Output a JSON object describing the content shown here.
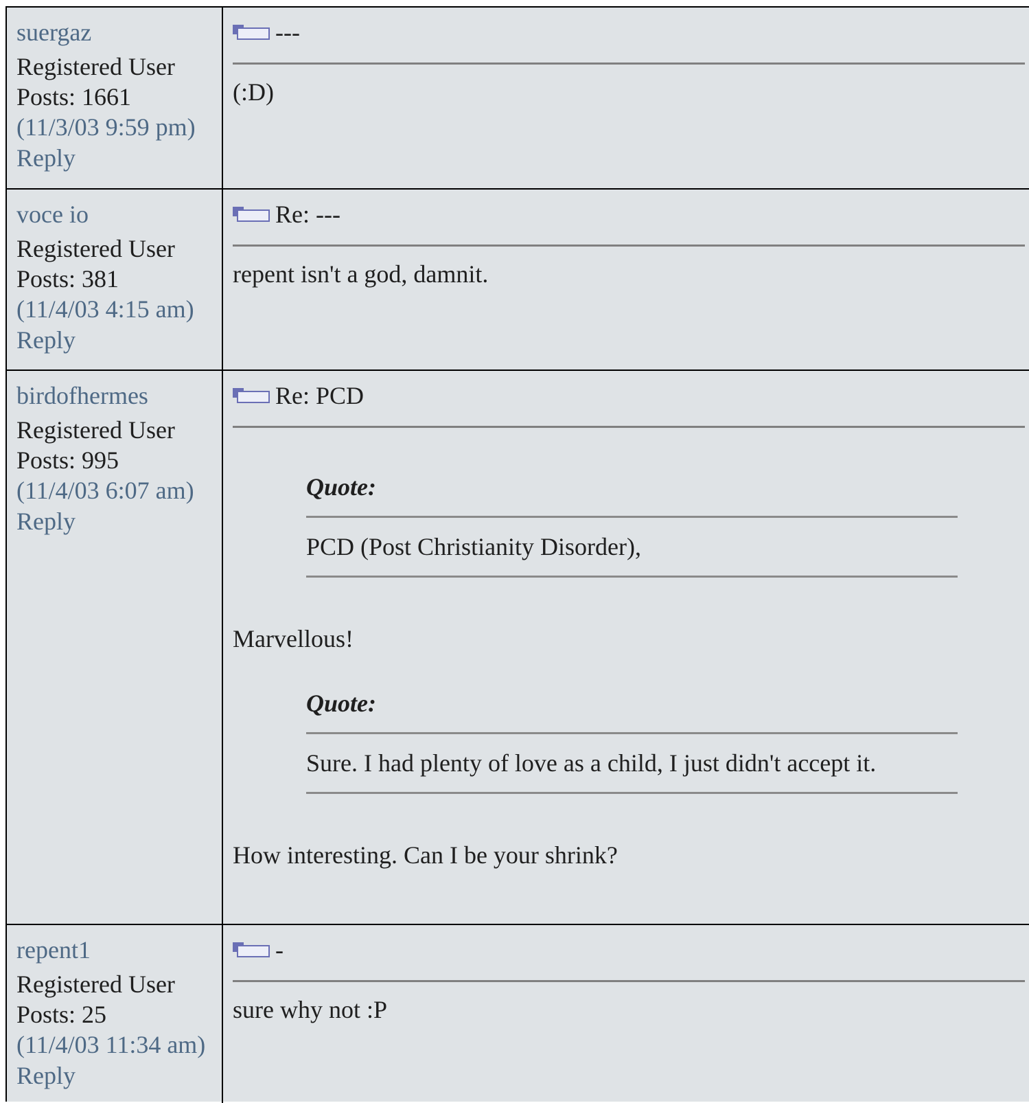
{
  "posts": [
    {
      "author": "suergaz",
      "rank": "Registered User",
      "posts_count": "Posts: 1661",
      "date": "(11/3/03 9:59 pm)",
      "reply": "Reply",
      "subject": "---",
      "body": [
        "(:D)"
      ]
    },
    {
      "author": "voce io",
      "rank": "Registered User",
      "posts_count": "Posts: 381",
      "date": "(11/4/03 4:15 am)",
      "reply": "Reply",
      "subject": "Re: ---",
      "body": [
        "repent isn't a god, damnit."
      ]
    },
    {
      "author": "birdofhermes",
      "rank": "Registered User",
      "posts_count": "Posts: 995",
      "date": "(11/4/03 6:07 am)",
      "reply": "Reply",
      "subject": "Re: PCD",
      "quote_label": "Quote:",
      "quote1": "PCD (Post Christianity Disorder),",
      "reply1": "Marvellous!",
      "quote2": "Sure. I had plenty of love as a child, I just didn't accept it.",
      "reply2": "How interesting. Can I be your shrink?"
    },
    {
      "author": "repent1",
      "rank": "Registered User",
      "posts_count": "Posts: 25",
      "date": "(11/4/03 11:34 am)",
      "reply": "Reply",
      "subject": "-",
      "body": [
        "sure why not :P"
      ]
    }
  ],
  "colors": {
    "background": "#dfe3e6",
    "link": "#4e6985",
    "text": "#1f1f1f",
    "icon_accent": "#6a6fb5"
  },
  "icons": {
    "post_icon": "post-icon"
  }
}
